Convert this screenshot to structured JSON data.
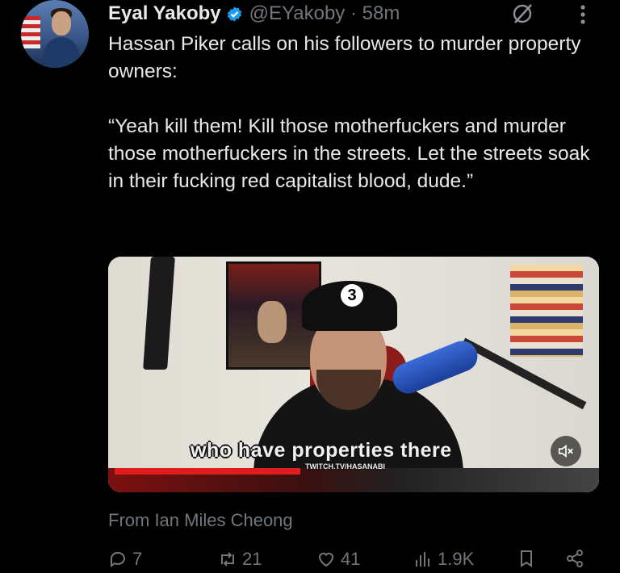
{
  "author": {
    "name": "Eyal Yakoby",
    "handle": "@EYakoby",
    "separator": "·",
    "time": "58m",
    "verified": true,
    "verified_color": "#1d9bf0"
  },
  "tweet": {
    "paragraphs": [
      "Hassan Piker calls on his followers to murder property owners:",
      "“Yeah kill them! Kill those motherfuckers and murder those motherfuckers in the streets. Let the streets soak in their fucking red capitalist blood, dude.”"
    ]
  },
  "media": {
    "subtitle": "who have properties there",
    "watermark": "TWITCH.TV/HASANABI",
    "mute_icon": "speaker-muted-icon"
  },
  "attribution": "From Ian Miles Cheong",
  "actions": {
    "reply_count": "7",
    "retweet_count": "21",
    "like_count": "41",
    "views_count": "1.9K"
  },
  "colors": {
    "background": "#000000",
    "text": "#e7e9ea",
    "secondary": "#71767b"
  }
}
